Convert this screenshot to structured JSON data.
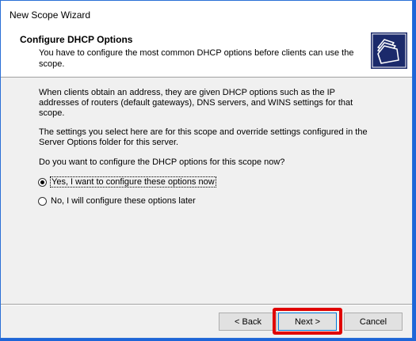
{
  "window": {
    "title": "New Scope Wizard"
  },
  "header": {
    "title": "Configure DHCP Options",
    "subtitle": "You have to configure the most common DHCP options before clients can use the scope.",
    "icon": "folders-icon"
  },
  "body": {
    "paragraph1": "When clients obtain an address, they are given DHCP options such as the IP addresses of routers (default gateways), DNS servers, and WINS settings for that scope.",
    "paragraph2": "The settings you select here are for this scope and override settings configured in the Server Options folder for this server.",
    "question": "Do you want to configure the DHCP options for this scope now?",
    "options": [
      {
        "label": "Yes, I want to configure these options now",
        "selected": true
      },
      {
        "label": "No, I will configure these options later",
        "selected": false
      }
    ]
  },
  "footer": {
    "back_label": "< Back",
    "next_label": "Next >",
    "cancel_label": "Cancel"
  },
  "colors": {
    "highlight": "#e00000",
    "desktop": "#1e66d8"
  }
}
